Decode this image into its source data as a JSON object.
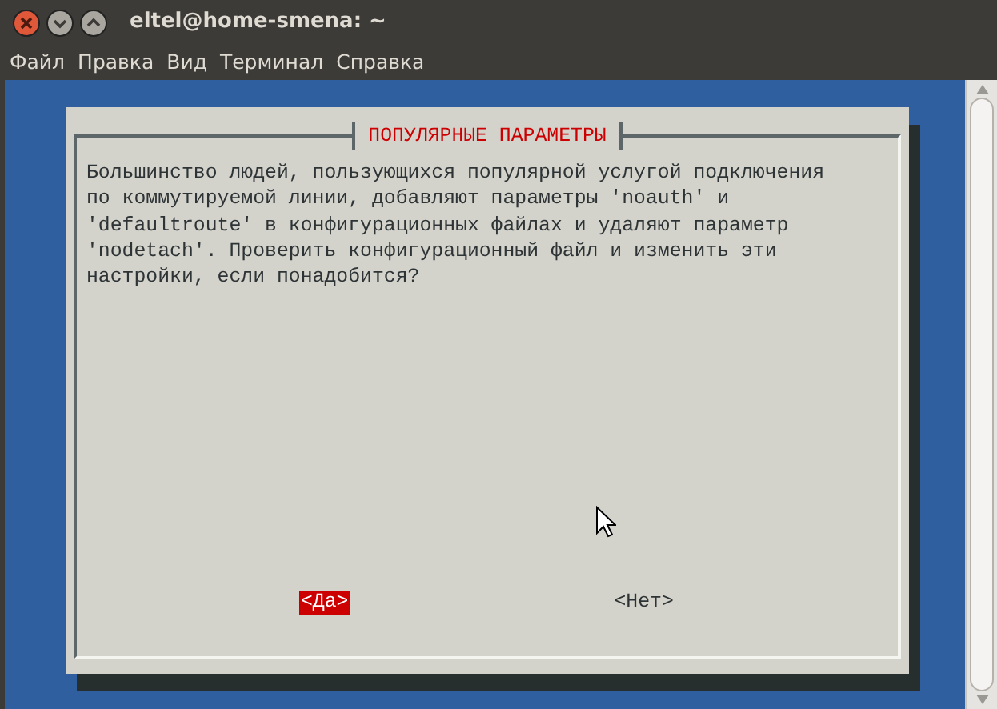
{
  "window": {
    "title": "eltel@home-smena: ~"
  },
  "menu": [
    "Файл",
    "Правка",
    "Вид",
    "Терминал",
    "Справка"
  ],
  "dialog": {
    "title": "ПОПУЛЯРНЫЕ ПАРАМЕТРЫ",
    "message": "Большинство людей, пользующихся популярной услугой подключения по коммутируемой линии, добавляют параметры 'noauth' и 'defaultroute' в конфигурационных файлах и удаляют параметр 'nodetach'. Проверить конфигурационный файл и изменить эти настройки, если понадобится?",
    "buttons": [
      {
        "label": "<Да>",
        "selected": true
      },
      {
        "label": "<Нет>",
        "selected": false
      }
    ]
  }
}
